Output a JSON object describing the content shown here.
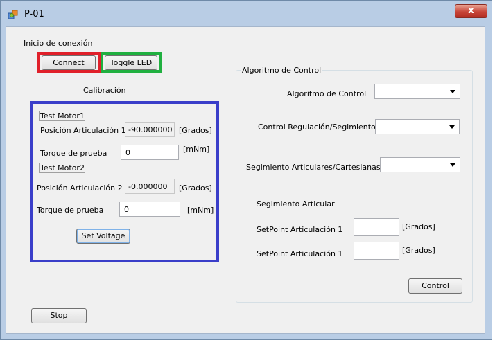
{
  "window": {
    "title": "P-01",
    "close_symbol": "x",
    "icon": "app-icon",
    "close_icon": "close-icon"
  },
  "connection": {
    "section_label": "Inicio de conexión",
    "connect_label": "Connect",
    "toggle_led_label": "Toggle LED"
  },
  "calibration": {
    "title": "Calibración",
    "motor1": {
      "label": "Test Motor1",
      "position_label": "Posición Articulación 1",
      "position_value": "-90.000000",
      "position_unit": "[Grados]",
      "torque_label": "Torque de prueba",
      "torque_value": "0",
      "torque_unit": "[mNm]"
    },
    "motor2": {
      "label": "Test Motor2",
      "position_label": "Posición Articulación 2",
      "position_value": "-0.000000",
      "position_unit": "[Grados]",
      "torque_label": "Torque de prueba",
      "torque_value": "0",
      "torque_unit": "[mNm]"
    },
    "set_voltage_label": "Set Voltage"
  },
  "control": {
    "group_title": "Algoritmo de Control",
    "algorithm_label": "Algoritmo de Control",
    "algorithm_value": "",
    "regulation_label": "Control Regulación/Segimiento",
    "regulation_value": "",
    "tracking_label": "Segimiento Articulares/Cartesianas",
    "tracking_value": "",
    "joint_tracking_label": "Segimiento Articular",
    "setpoint1_label": "SetPoint Articulación 1",
    "setpoint1_value": "",
    "setpoint1_unit": "[Grados]",
    "setpoint2_label": "SetPoint Articulación 1",
    "setpoint2_value": "",
    "setpoint2_unit": "[Grados]",
    "control_button_label": "Control"
  },
  "stop_label": "Stop",
  "colors": {
    "connect_highlight": "#e0202a",
    "toggle_highlight": "#20b040",
    "calibration_highlight": "#3a3ec9",
    "title_bar": "#b9cde5",
    "close_button": "#c8463a"
  }
}
